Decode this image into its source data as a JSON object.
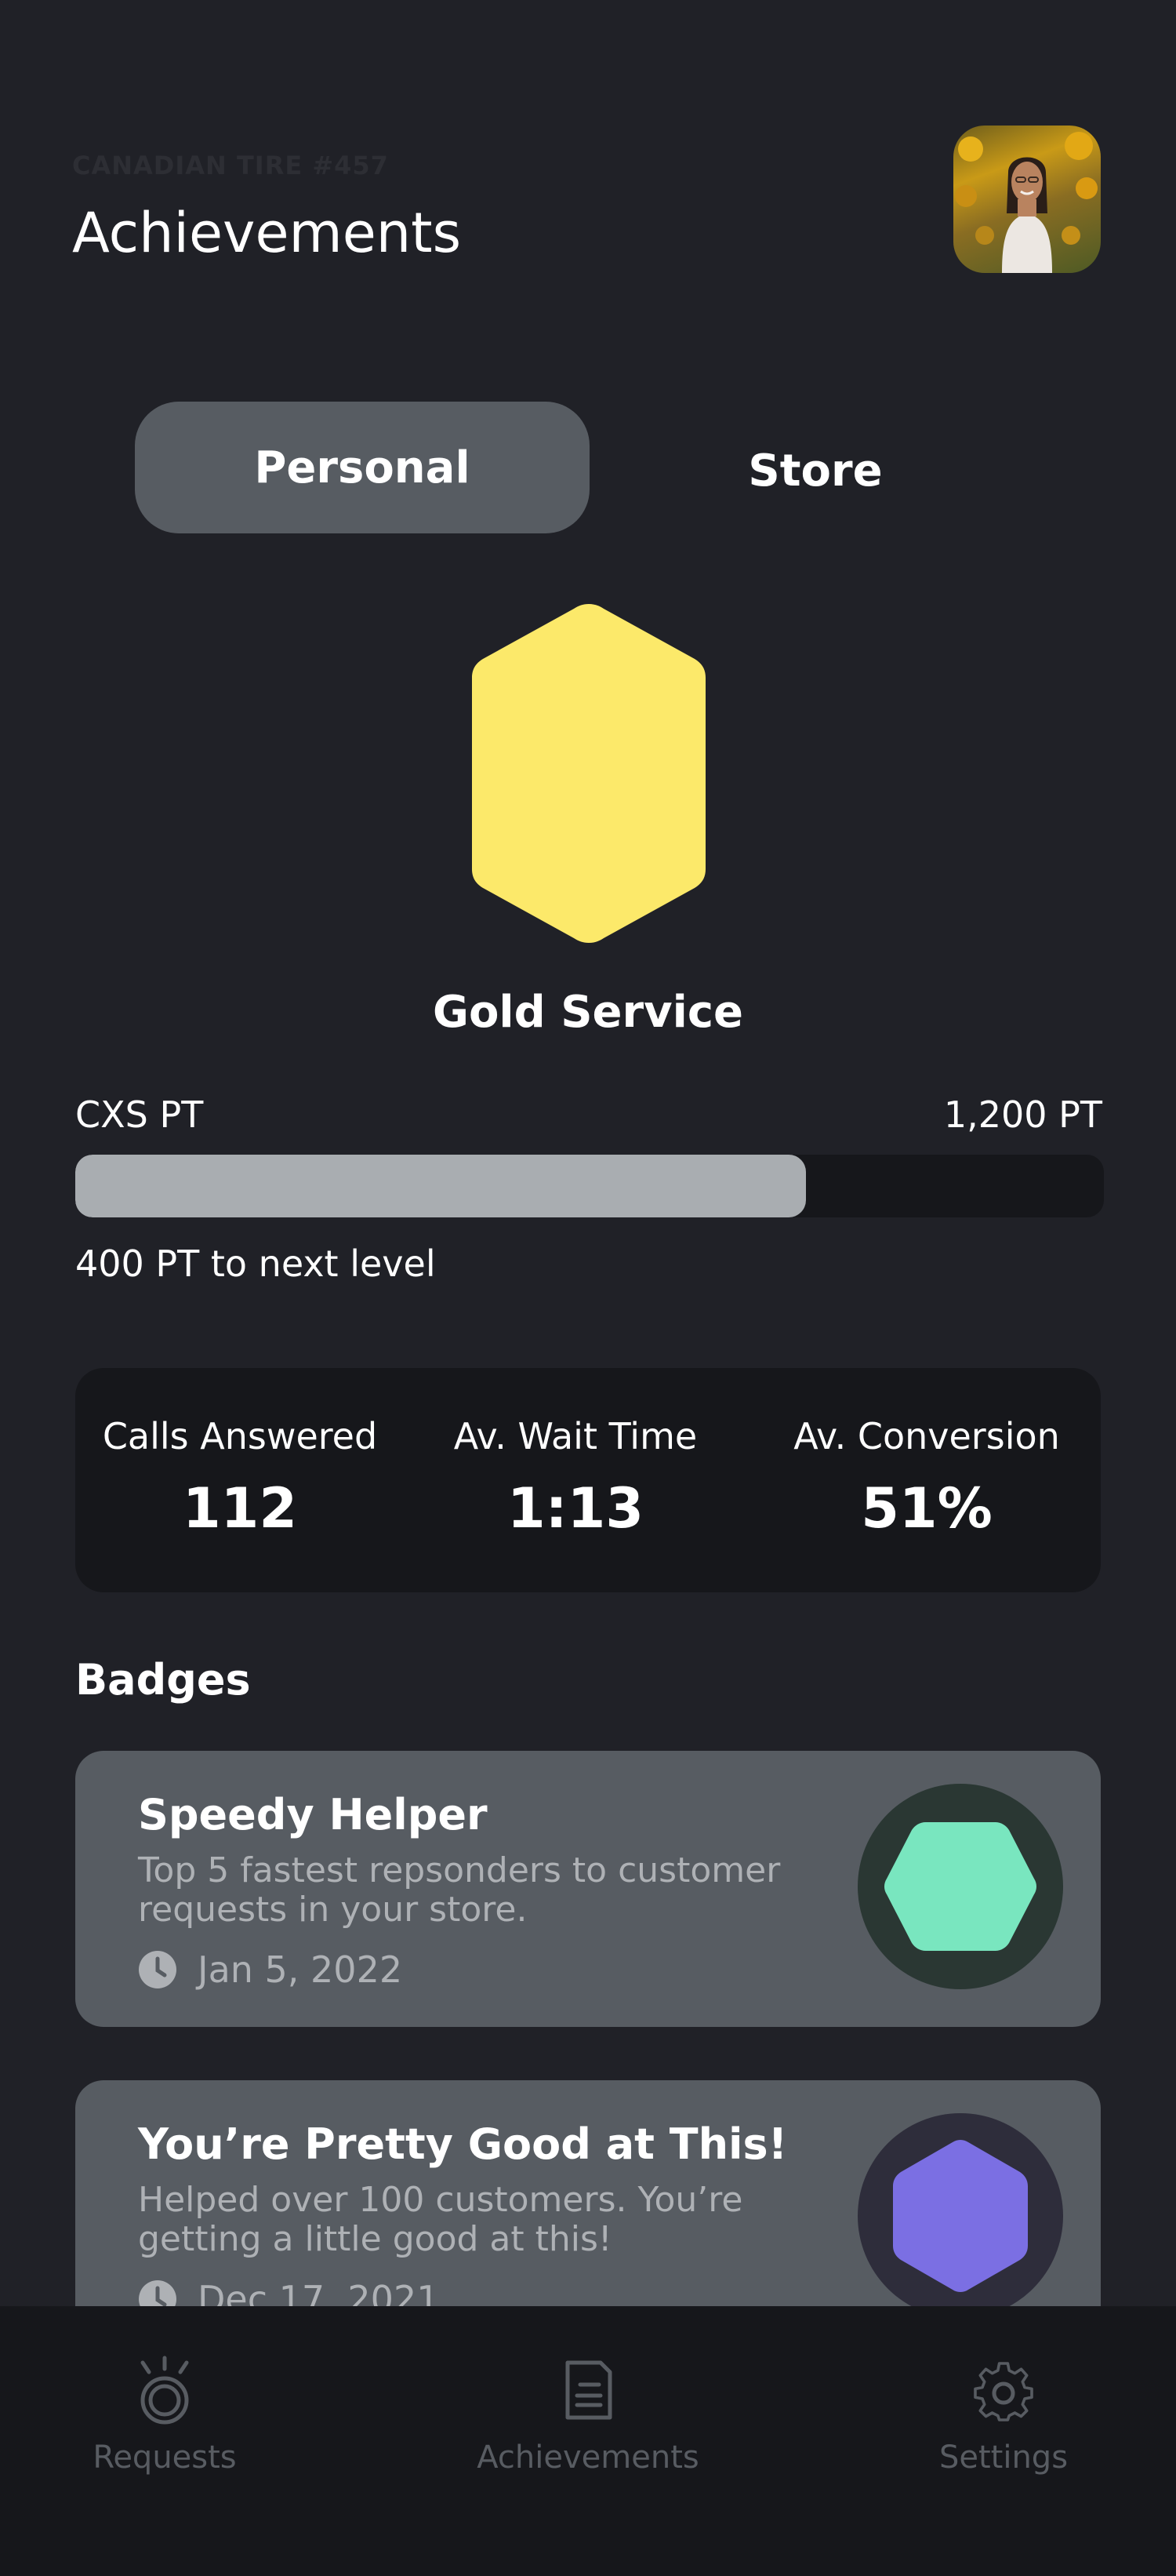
{
  "header": {
    "store_name": "CANADIAN TIRE #457",
    "title": "Achievements",
    "avatar_icon": "profile-photo"
  },
  "tabs": [
    {
      "label": "Personal",
      "active": true
    },
    {
      "label": "Store",
      "active": false
    }
  ],
  "level": {
    "name": "Gold Service",
    "badge_color": "#fce96a",
    "points_label": "CXS PT",
    "points_total": "1,200 PT",
    "progress_fraction": 0.71,
    "next_level_text": "400 PT to next level"
  },
  "stats": [
    {
      "label": "Calls Answered",
      "value": "112"
    },
    {
      "label": "Av. Wait Time",
      "value": "1:13"
    },
    {
      "label": "Av. Conversion",
      "value": "51%"
    }
  ],
  "badges_heading": "Badges",
  "badges": [
    {
      "title": "Speedy Helper",
      "description": "Top 5 fastest repsonders to customer requests in your store.",
      "date": "Jan 5, 2022",
      "color": "#79e6bf",
      "ring_color": "#2a3733"
    },
    {
      "title": "You’re Pretty Good at This!",
      "description": "Helped over 100 customers. You’re getting a little good at this!",
      "date": "Dec 17, 2021",
      "color": "#7b6fe3",
      "ring_color": "#2e2d3b"
    }
  ],
  "nav": [
    {
      "label": "Requests",
      "icon": "requests-icon"
    },
    {
      "label": "Achievements",
      "icon": "achievements-icon"
    },
    {
      "label": "Settings",
      "icon": "gear-icon"
    }
  ],
  "colors": {
    "background": "#202127",
    "card": "#575c62",
    "dark_card": "#16171b",
    "muted_text": "#aeb1b5"
  }
}
